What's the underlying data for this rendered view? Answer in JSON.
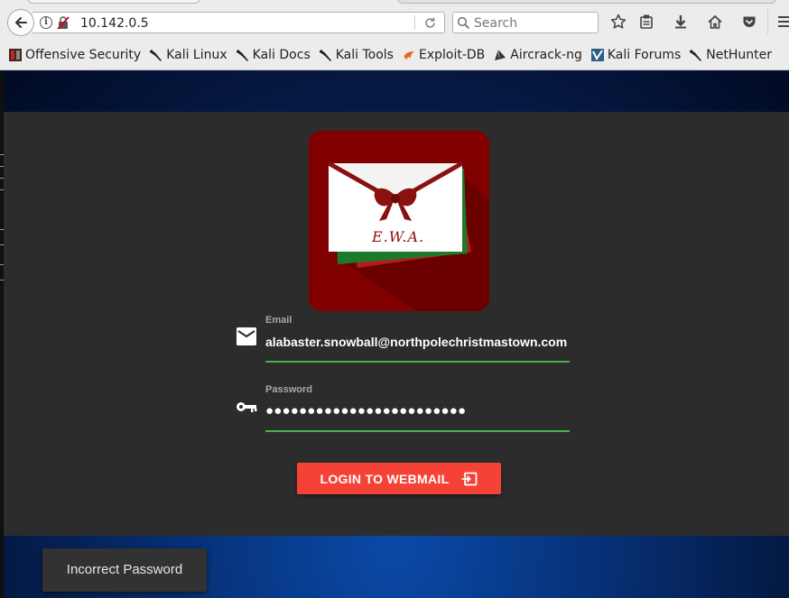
{
  "browser": {
    "url": "10.142.0.5",
    "search_placeholder": "Search",
    "toolbar_icons": [
      "star-icon",
      "reading-list-icon",
      "download-icon",
      "home-icon",
      "pocket-icon",
      "menu-icon"
    ],
    "bookmarks": [
      {
        "label": "Offensive Security",
        "icon": "offsec-icon"
      },
      {
        "label": "Kali Linux",
        "icon": "kali-dragon-icon"
      },
      {
        "label": "Kali Docs",
        "icon": "kali-dragon-icon"
      },
      {
        "label": "Kali Tools",
        "icon": "kali-dragon-icon"
      },
      {
        "label": "Exploit-DB",
        "icon": "exploitdb-icon"
      },
      {
        "label": "Aircrack-ng",
        "icon": "aircrack-icon"
      },
      {
        "label": "Kali Forums",
        "icon": "kali-forums-icon"
      },
      {
        "label": "NetHunter",
        "icon": "kali-dragon-icon"
      }
    ]
  },
  "login": {
    "logo_text": "E.W.A.",
    "email_label": "Email",
    "email_value": "alabaster.snowball@northpolechristmastown.com",
    "password_label": "Password",
    "password_value": "●●●●●●●●●●●●●●●●●●●●●●●●",
    "submit_label": "LOGIN TO WEBMAIL"
  },
  "toast": {
    "message": "Incorrect Password"
  },
  "colors": {
    "accent_red": "#f44336",
    "field_underline": "#4caf50",
    "panel_bg": "#2c2c2c",
    "logo_bg": "#800000"
  }
}
